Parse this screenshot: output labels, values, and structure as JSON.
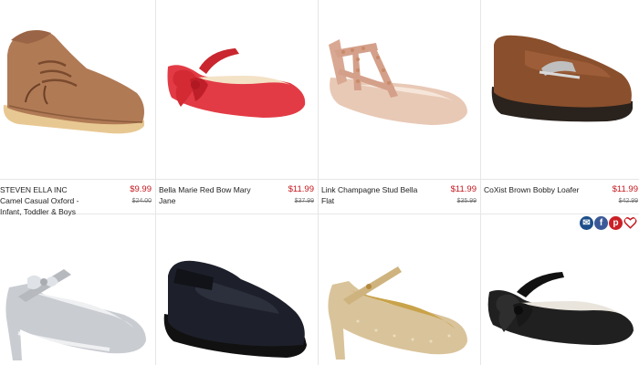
{
  "products": [
    {
      "name": "STEVEN ELLA INC Camel Casual Oxford - Infant, Toddler & Boys",
      "price": "$9.99",
      "old_price": "$24.00"
    },
    {
      "name": "Bella Marie Red Bow Mary Jane",
      "price": "$11.99",
      "old_price": "$37.99"
    },
    {
      "name": "Link Champagne Stud Bella Flat",
      "price": "$11.99",
      "old_price": "$35.99"
    },
    {
      "name": "CoXist Brown Bobby Loafer",
      "price": "$11.99",
      "old_price": "$42.99"
    }
  ],
  "share_icons": [
    "email-icon",
    "facebook-icon",
    "pinterest-icon",
    "heart-icon"
  ],
  "colors": {
    "price": "#c4161c",
    "email": "#1c4e8a",
    "facebook": "#3b5998",
    "pinterest": "#cb2027",
    "heart": "#c4161c"
  }
}
